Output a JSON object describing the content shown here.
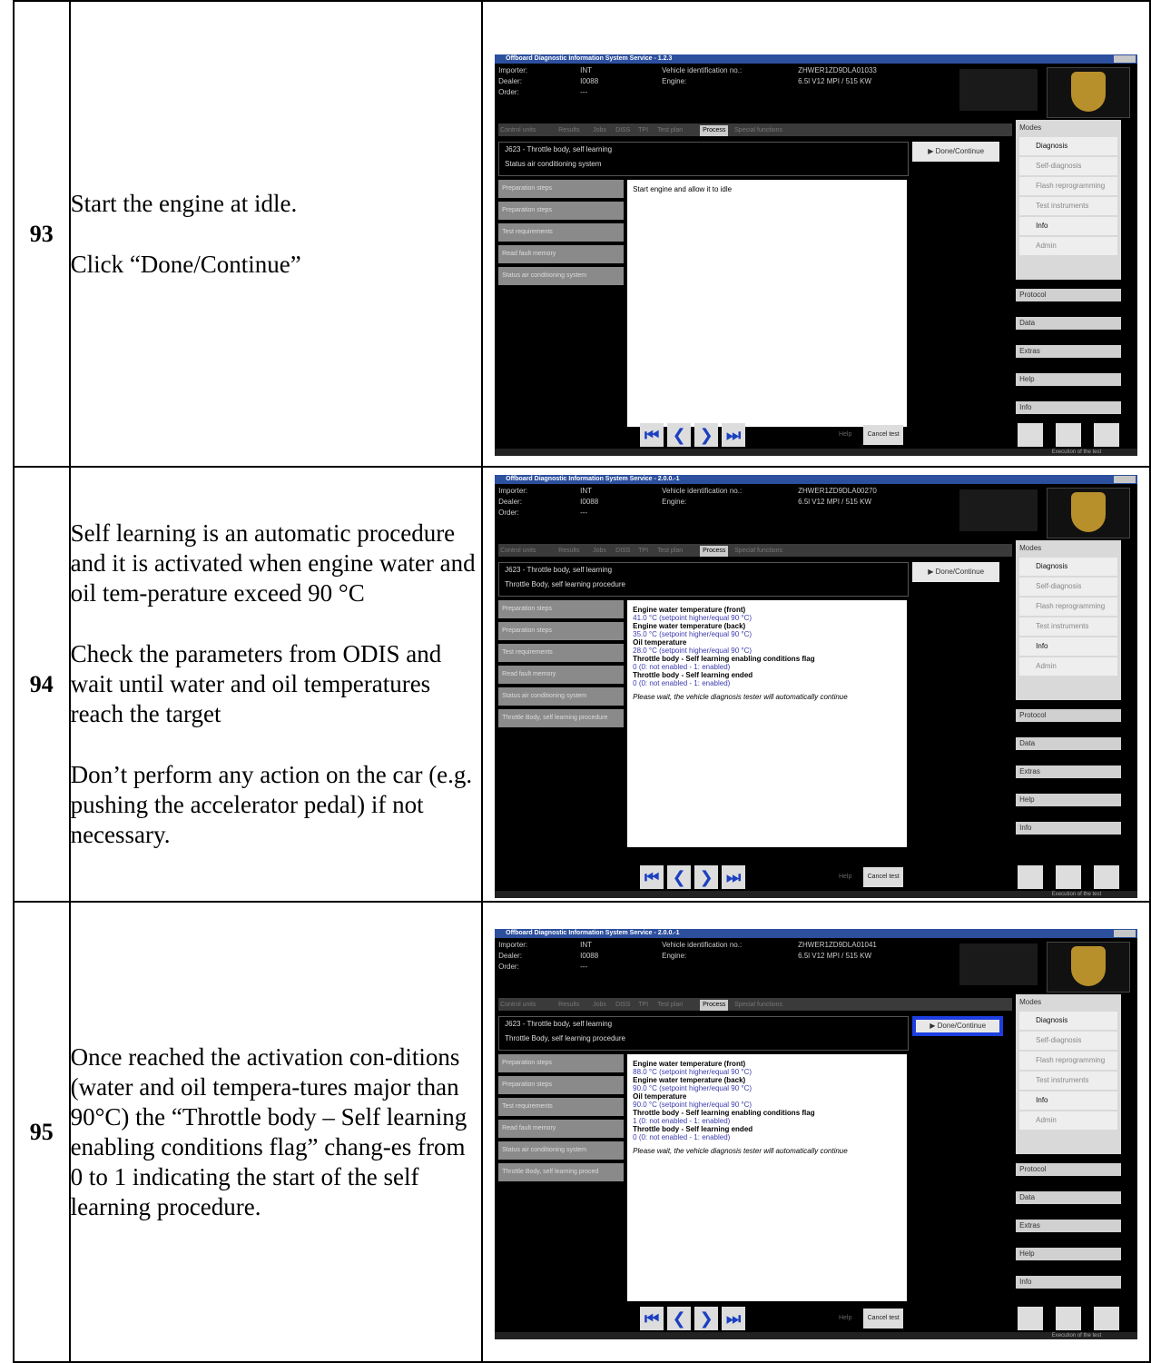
{
  "rows": [
    {
      "number": "93",
      "paragraphs": [
        "Start the engine at idle.",
        "Click “Done/Continue”"
      ],
      "screenshot": {
        "title": "Offboard Diagnostic Information System Service - 1.2.3",
        "importer_label": "Importer:",
        "importer": "INT",
        "dealer_label": "Dealer:",
        "dealer": "I0088",
        "order_label": "Order:",
        "order": "---",
        "vin_label": "Vehicle identification no.:",
        "vin": "ZHWER1ZD9DLA01033",
        "engine_label": "Engine:",
        "engine": "6.5l V12 MPI / 515 KW",
        "active_tab": "Process",
        "control_title": "J623 - Throttle body, self learning",
        "procedure": "Status air conditioning system",
        "done_label": "Done/Continue",
        "steps": [
          "Preparation steps",
          "Preparation steps",
          "Test requirements",
          "Read fault memory",
          "Status air conditioning system"
        ],
        "content": [
          {
            "t": "Start engine and allow it to idle",
            "k": "plain"
          }
        ],
        "cancel_label": "Cancel test"
      }
    },
    {
      "number": "94",
      "paragraphs": [
        "Self learning is an automatic procedure and it is activated when engine water and oil tem-perature exceed 90 °C",
        "Check the parameters from ODIS and wait until water and oil temperatures reach the target",
        "Don’t perform any action on the car (e.g. pushing the accelerator pedal) if not necessary."
      ],
      "screenshot": {
        "title": "Offboard Diagnostic Information System Service - 2.0.0.-1",
        "importer_label": "Importer:",
        "importer": "INT",
        "dealer_label": "Dealer:",
        "dealer": "I0088",
        "order_label": "Order:",
        "order": "---",
        "vin_label": "Vehicle identification no.:",
        "vin": "ZHWER1ZD9DLA00270",
        "engine_label": "Engine:",
        "engine": "6.5l V12 MPI / 515 KW",
        "active_tab": "Process",
        "control_title": "J623 - Throttle body, self learning",
        "procedure": "Throttle Body, self learning procedure",
        "done_label": "Done/Continue",
        "steps": [
          "Preparation steps",
          "Preparation steps",
          "Test requirements",
          "Read fault memory",
          "Status air conditioning system",
          "Throttle Body, self learning procedure"
        ],
        "content": [
          {
            "t": "Engine water temperature (front)",
            "k": "b"
          },
          {
            "t": "41.0 °C (setpoint higher/equal 90 °C)",
            "k": "v"
          },
          {
            "t": "Engine water temperature (back)",
            "k": "b"
          },
          {
            "t": "35.0 °C (setpoint higher/equal 90 °C)",
            "k": "v"
          },
          {
            "t": "Oil temperature",
            "k": "b"
          },
          {
            "t": "28.0 °C (setpoint higher/equal 90 °C)",
            "k": "v"
          },
          {
            "t": "Throttle body - Self learning enabling conditions flag",
            "k": "b"
          },
          {
            "t": "0 (0: not enabled - 1: enabled)",
            "k": "v"
          },
          {
            "t": "Throttle body - Self learning ended",
            "k": "b"
          },
          {
            "t": "0 (0: not enabled - 1: enabled)",
            "k": "v"
          },
          {
            "t": "Please wait, the vehicle diagnosis tester will automatically continue",
            "k": "w"
          }
        ],
        "cancel_label": "Cancel test"
      }
    },
    {
      "number": "95",
      "paragraphs": [
        "Once reached the activation con-ditions (water and oil tempera-tures major than 90°C) the “Throttle body – Self learning enabling conditions flag” chang-es from 0 to 1 indicating the start of the self learning procedure."
      ],
      "screenshot": {
        "title": "Offboard Diagnostic Information System Service - 2.0.0.-1",
        "importer_label": "Importer:",
        "importer": "INT",
        "dealer_label": "Dealer:",
        "dealer": "I0088",
        "order_label": "Order:",
        "order": "---",
        "vin_label": "Vehicle identification no.:",
        "vin": "ZHWER1ZD9DLA01041",
        "engine_label": "Engine:",
        "engine": "6.5l V12 MPI / 515 KW",
        "active_tab": "Process",
        "control_title": "J623 - Throttle body, self learning",
        "procedure": "Throttle Body, self learning procedure",
        "done_label": "Done/Continue",
        "steps": [
          "Preparation steps",
          "Preparation steps",
          "Test requirements",
          "Read fault memory",
          "Status air conditioning system",
          "Throttle Body, self learning proced"
        ],
        "content": [
          {
            "t": "Engine water temperature (front)",
            "k": "b"
          },
          {
            "t": "88.0 °C (setpoint higher/equal 90 °C)",
            "k": "v"
          },
          {
            "t": "Engine water temperature (back)",
            "k": "b"
          },
          {
            "t": "90.0 °C (setpoint higher/equal 90 °C)",
            "k": "v"
          },
          {
            "t": "Oil temperature",
            "k": "b"
          },
          {
            "t": "90.0 °C (setpoint higher/equal 90 °C)",
            "k": "v"
          },
          {
            "t": "Throttle body - Self learning enabling conditions flag",
            "k": "b"
          },
          {
            "t": "1 (0: not enabled - 1: enabled)",
            "k": "v"
          },
          {
            "t": "Throttle body - Self learning ended",
            "k": "b"
          },
          {
            "t": "0 (0: not enabled - 1: enabled)",
            "k": "v"
          },
          {
            "t": "Please wait, the vehicle diagnosis tester will automatically continue",
            "k": "w"
          }
        ],
        "cancel_label": "Cancel test"
      }
    }
  ],
  "odis_common": {
    "tabs": [
      "Control units",
      "Results",
      "Jobs",
      "DISS",
      "TPI",
      "Test plan",
      "Process",
      "Special functions"
    ],
    "modes_label": "Modes",
    "modes": [
      "Diagnosis",
      "Self-diagnosis",
      "Flash reprogramming",
      "Test instruments",
      "Info",
      "Admin"
    ],
    "menus": [
      "Protocol",
      "Data",
      "Extras",
      "Help",
      "Info"
    ],
    "help_label": "Help",
    "status": "Execution of the test"
  },
  "colors": {
    "highlight_border": "#1d3ee0",
    "odis_background": "#000000"
  }
}
